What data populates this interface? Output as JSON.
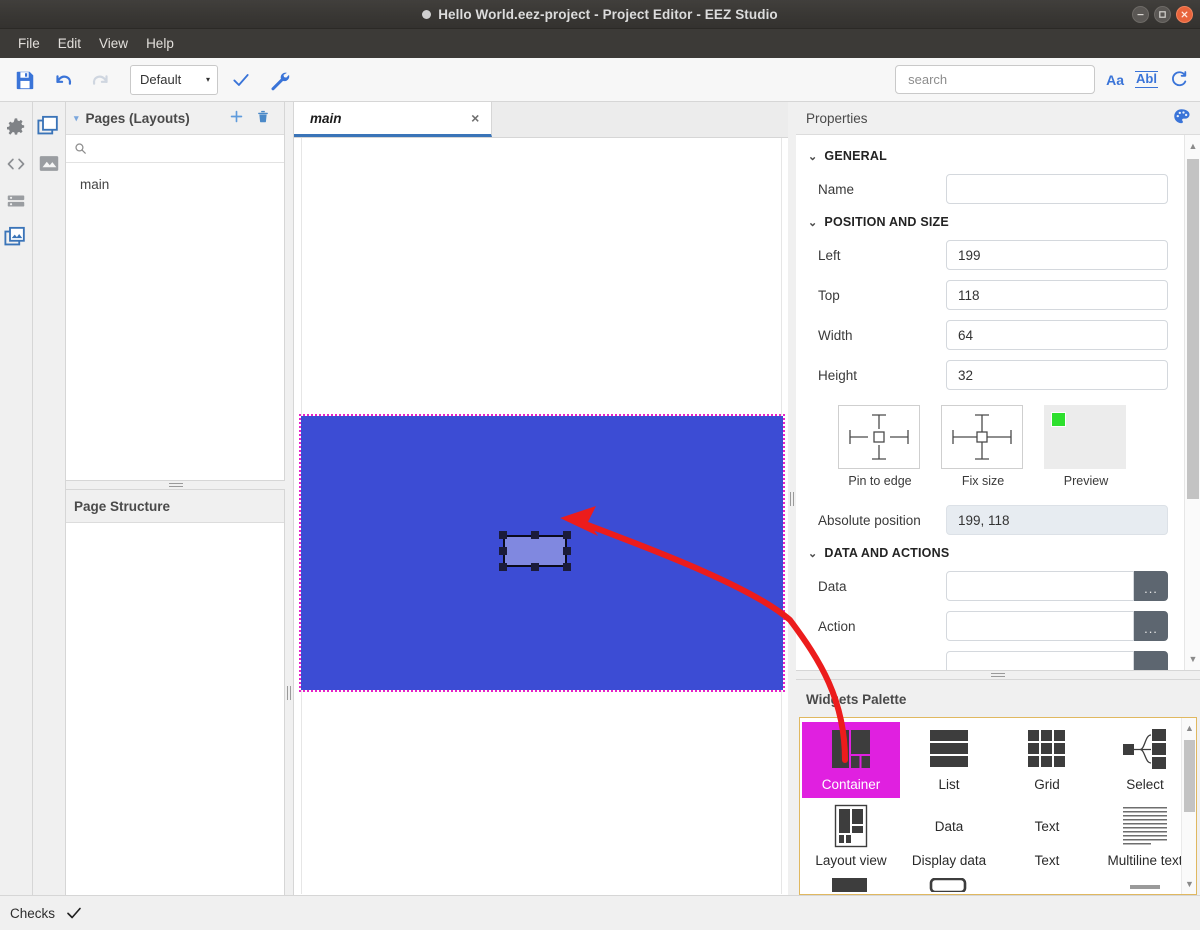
{
  "window": {
    "title": "Hello World.eez-project - Project Editor - EEZ Studio",
    "controls": {
      "minimize": "minimize-button",
      "maximize": "maximize-button",
      "close": "close-button"
    }
  },
  "menubar": {
    "items": [
      "File",
      "Edit",
      "View",
      "Help"
    ]
  },
  "toolbar": {
    "save_icon": "save-icon",
    "undo_icon": "undo-icon",
    "redo_icon": "redo-icon",
    "configuration": {
      "value": "Default",
      "caret": "▾"
    },
    "check_icon": "check-icon",
    "build_icon": "wrench-icon",
    "search": {
      "placeholder": "search",
      "value": ""
    },
    "match_case_icon": "Aa",
    "match_whole_word_icon": "Abl",
    "refresh_icon": "refresh-icon"
  },
  "rail": {
    "primary": [
      "settings-icon",
      "code-icon",
      "database-icon",
      "pages-icon"
    ],
    "secondary": [
      "layouts-icon",
      "image-icon"
    ]
  },
  "pages_panel": {
    "title": "Pages (Layouts)",
    "caret": "▾",
    "add_label": "+",
    "delete_label": "delete-icon",
    "search_placeholder": "",
    "items": [
      "main"
    ]
  },
  "page_structure": {
    "title": "Page Structure",
    "items": []
  },
  "editor": {
    "tabs": [
      {
        "label": "main",
        "close": "×",
        "active": true
      }
    ],
    "canvas": {
      "page_background": "#3c4cd4",
      "selection_outline": "#e822c8",
      "selected_widget_fill": "#8088e0",
      "selected_widget_border": "#0a0a1a"
    }
  },
  "properties": {
    "title": "Properties",
    "palette_icon": "palette-icon",
    "groups": [
      {
        "title": "GENERAL",
        "caret": "⌄",
        "rows": [
          {
            "label": "Name",
            "value": "",
            "type": "text"
          }
        ]
      },
      {
        "title": "POSITION AND SIZE",
        "caret": "⌄",
        "rows": [
          {
            "label": "Left",
            "value": "199",
            "type": "text"
          },
          {
            "label": "Top",
            "value": "118",
            "type": "text"
          },
          {
            "label": "Width",
            "value": "64",
            "type": "text"
          },
          {
            "label": "Height",
            "value": "32",
            "type": "text"
          }
        ],
        "figures": [
          {
            "caption": "Pin to edge",
            "icon": "pin-to-edge-icon"
          },
          {
            "caption": "Fix size",
            "icon": "fix-size-icon"
          },
          {
            "caption": "Preview",
            "icon": "preview-icon"
          }
        ],
        "absolute_position": {
          "label": "Absolute position",
          "value": "199, 118"
        }
      },
      {
        "title": "DATA AND ACTIONS",
        "caret": "⌄",
        "rows": [
          {
            "label": "Data",
            "value": "",
            "type": "picker",
            "button": "..."
          },
          {
            "label": "Action",
            "value": "",
            "type": "picker",
            "button": "..."
          },
          {
            "label": "",
            "value": "",
            "type": "picker",
            "button": "..."
          }
        ]
      }
    ]
  },
  "widgets_palette": {
    "title": "Widgets Palette",
    "items": [
      {
        "label": "Container",
        "icon": "container-icon",
        "selected": true
      },
      {
        "label": "List",
        "icon": "list-icon",
        "selected": false
      },
      {
        "label": "Grid",
        "icon": "grid-icon",
        "selected": false
      },
      {
        "label": "Select",
        "icon": "select-icon",
        "selected": false
      },
      {
        "label": "Layout view",
        "icon": "layout-view-icon",
        "selected": false
      },
      {
        "label": "Display data",
        "icon": "display-data-icon",
        "icon_text": "Data",
        "selected": false
      },
      {
        "label": "Text",
        "icon": "text-icon",
        "icon_text": "Text",
        "selected": false
      },
      {
        "label": "Multiline text",
        "icon": "multiline-text-icon",
        "selected": false
      }
    ]
  },
  "statusbar": {
    "label": "Checks",
    "icon": "check-icon"
  },
  "colors": {
    "accent": "#3a74b8",
    "selection_magenta": "#e020e0",
    "annotation_red": "#ec1c1c",
    "canvas_blue": "#3c4cd4",
    "palette_border": "#e0b860"
  }
}
